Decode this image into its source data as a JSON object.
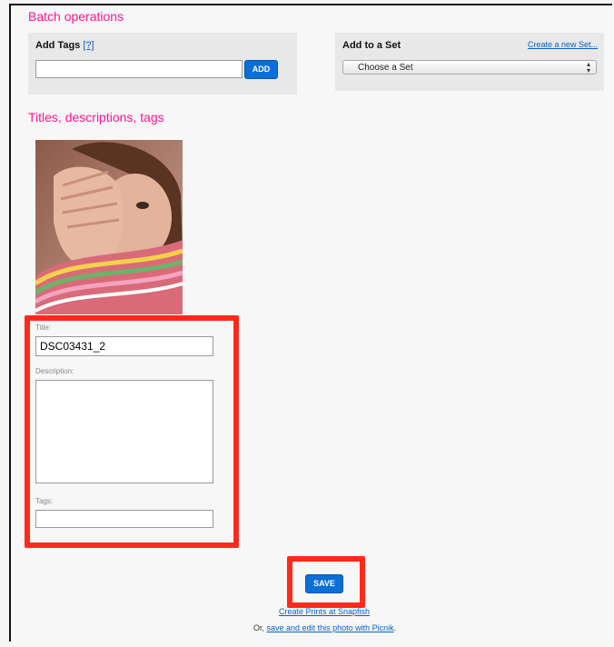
{
  "batch": {
    "heading": "Batch operations",
    "add_tags_label": "Add Tags",
    "add_tags_help": "[?]",
    "add_tags_value": "",
    "add_button": "ADD",
    "add_to_set_label": "Add to a Set",
    "create_set_link": "Create a new Set...",
    "set_select_value": "Choose a Set"
  },
  "details": {
    "heading": "Titles, descriptions, tags",
    "photo_icon": "photo-thumbnail",
    "title_label": "Title:",
    "title_value": "DSC03431_2",
    "description_label": "Description:",
    "description_value": "",
    "tags_label": "Tags:",
    "tags_value": ""
  },
  "footer": {
    "save_button": "SAVE",
    "prints_link": "Create Prints at Snapfish",
    "or_text": "Or,",
    "picnik_link": "save and edit this photo with Picnik",
    "period": "."
  },
  "colors": {
    "heading_pink": "#ff1493",
    "button_blue": "#0a6fd8",
    "highlight_red": "#ff2a1a",
    "link_blue": "#0a5fc5"
  }
}
